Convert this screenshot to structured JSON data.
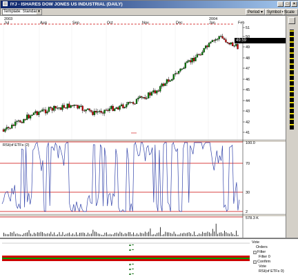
{
  "window": {
    "title": "IYJ - ISHARES DOW JONES US INDUSTRIAL (DAILY)",
    "buttons": [
      "_",
      "□",
      "×"
    ]
  },
  "toolbar": {
    "template_value": "Template: Standard",
    "menus": [
      "Period",
      "Symbol",
      "Scale"
    ]
  },
  "price_chart": {
    "years": [
      "2003",
      "2004"
    ],
    "months": [
      "Jul",
      "Aug",
      "Sep",
      "Oct",
      "Nov",
      "Dec",
      "Jan",
      "Feb"
    ],
    "y_ticks": [
      "51",
      "50",
      "49",
      "48",
      "47",
      "46",
      "45",
      "44",
      "43",
      "42",
      "41"
    ],
    "last_price": "49.59"
  },
  "rsi_panel": {
    "label": "RSI(of ETFs (2)",
    "y_ticks": [
      "100.0",
      "70",
      "30",
      "2"
    ]
  },
  "volume_panel": {
    "value": "578.3 K"
  },
  "bottom": {
    "tree_items": [
      {
        "label": "Vote",
        "box": ""
      },
      {
        "label": "Orders",
        "box": ""
      },
      {
        "label": "Filter",
        "box": "□"
      },
      {
        "label": "Filter 0",
        "box": ""
      },
      {
        "label": "Confirm",
        "box": "□"
      },
      {
        "label": "Vote",
        "box": ""
      },
      {
        "label": "RSI(of ETFs 0)",
        "box": ""
      }
    ]
  },
  "colors": {
    "up_candle": "#008000",
    "down_candle": "#cc0000",
    "rsi_line": "#3344aa",
    "band_line": "#cc0000",
    "strip_red": "#cc0000",
    "strip_green": "#00a000"
  }
}
